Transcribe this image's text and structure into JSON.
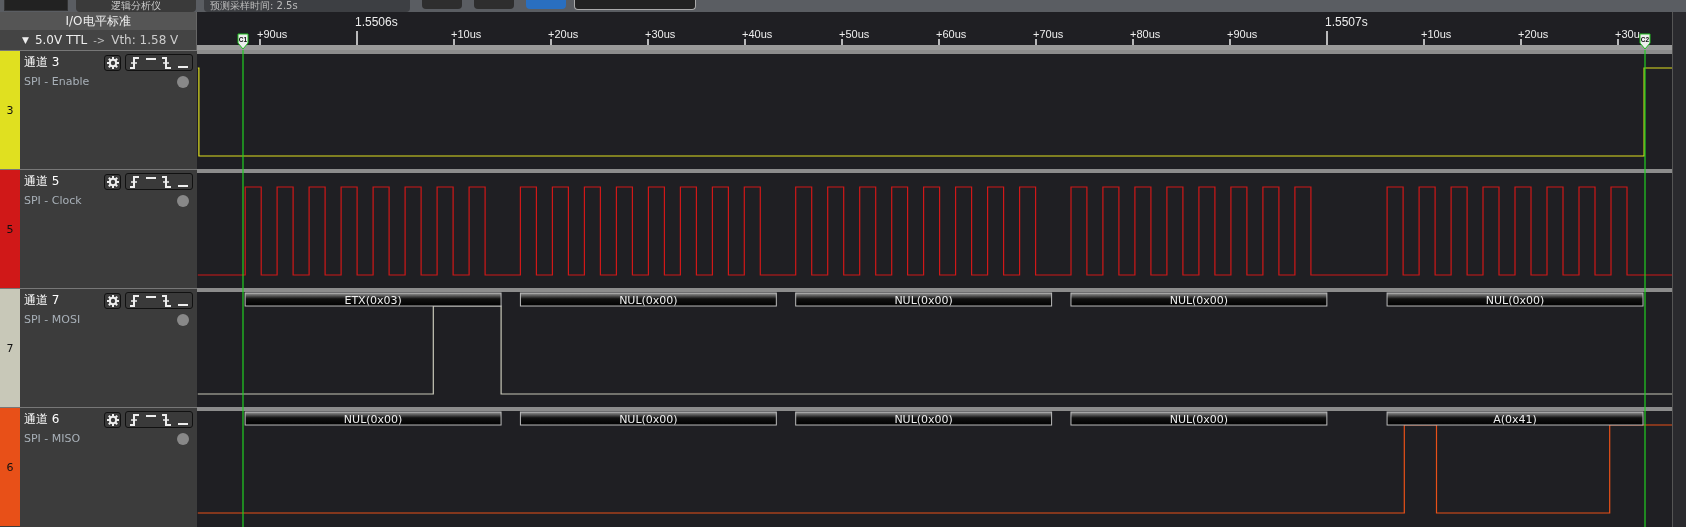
{
  "toolbar": {
    "mode": "逻辑分析仪",
    "sample_time": "预测采样时间: 2.5s"
  },
  "io_standard": {
    "title": "I/O电平标准",
    "caret": "▼",
    "value": "5.0V TTL",
    "arrow": "->",
    "threshold": "Vth: 1.58 V"
  },
  "ruler": {
    "ticks": [
      {
        "label": "+90us",
        "major": false
      },
      {
        "label": "1.5506s",
        "major": true
      },
      {
        "label": "+10us",
        "major": false
      },
      {
        "label": "+20us",
        "major": false
      },
      {
        "label": "+30us",
        "major": false
      },
      {
        "label": "+40us",
        "major": false
      },
      {
        "label": "+50us",
        "major": false
      },
      {
        "label": "+60us",
        "major": false
      },
      {
        "label": "+70us",
        "major": false
      },
      {
        "label": "+80us",
        "major": false
      },
      {
        "label": "+90us",
        "major": false
      },
      {
        "label": "1.5507s",
        "major": true
      },
      {
        "label": "+10us",
        "major": false
      },
      {
        "label": "+20us",
        "major": false
      },
      {
        "label": "+30u",
        "major": false
      }
    ],
    "cursors": [
      {
        "label": "C1"
      },
      {
        "label": "C2"
      }
    ]
  },
  "channels": [
    {
      "name": "通道 3",
      "number": "3",
      "function": "SPI - Enable",
      "color": "#e0e020",
      "kind": "enable"
    },
    {
      "name": "通道 5",
      "number": "5",
      "function": "SPI - Clock",
      "color": "#d01818",
      "kind": "clock"
    },
    {
      "name": "通道 7",
      "number": "7",
      "function": "SPI - MOSI",
      "color": "#c8c8b8",
      "kind": "mosi",
      "decoded": [
        "ETX(0x03)",
        "NUL(0x00)",
        "NUL(0x00)",
        "NUL(0x00)",
        "NUL(0x00)"
      ]
    },
    {
      "name": "通道 6",
      "number": "6",
      "function": "SPI - MISO",
      "color": "#e85018",
      "kind": "miso",
      "decoded": [
        "NUL(0x00)",
        "NUL(0x00)",
        "NUL(0x00)",
        "NUL(0x00)",
        "A(0x41)"
      ]
    }
  ]
}
